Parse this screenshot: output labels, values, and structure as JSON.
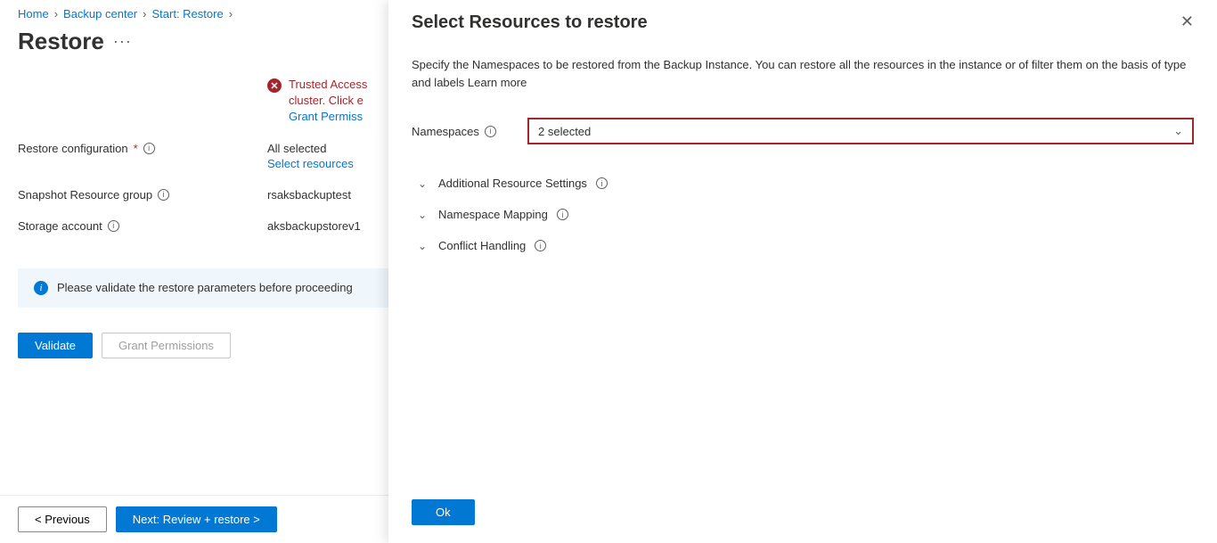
{
  "breadcrumb": {
    "home": "Home",
    "backup_center": "Backup center",
    "start_restore": "Start: Restore"
  },
  "page": {
    "title": "Restore",
    "more": "···"
  },
  "error": {
    "line1": "Trusted Access",
    "line2": "cluster. Click e",
    "link": "Grant Permiss"
  },
  "form": {
    "restore_config_label": "Restore configuration",
    "restore_config_value": "All selected",
    "select_resources_link": "Select resources",
    "snapshot_rg_label": "Snapshot Resource group",
    "snapshot_rg_value": "rsaksbackuptest",
    "storage_account_label": "Storage account",
    "storage_account_value": "aksbackupstorev1"
  },
  "info_bar": "Please validate the restore parameters before proceeding",
  "buttons": {
    "validate": "Validate",
    "grant_permissions": "Grant Permissions",
    "previous": "< Previous",
    "next": "Next: Review + restore >"
  },
  "panel": {
    "title": "Select Resources to restore",
    "description": "Specify the Namespaces to be restored from the Backup Instance. You can restore all the resources in the instance or of filter them on the basis of type and labels Learn more",
    "namespaces_label": "Namespaces",
    "namespaces_value": "2 selected",
    "accordion": {
      "additional": "Additional Resource Settings",
      "mapping": "Namespace Mapping",
      "conflict": "Conflict Handling"
    },
    "ok": "Ok"
  }
}
